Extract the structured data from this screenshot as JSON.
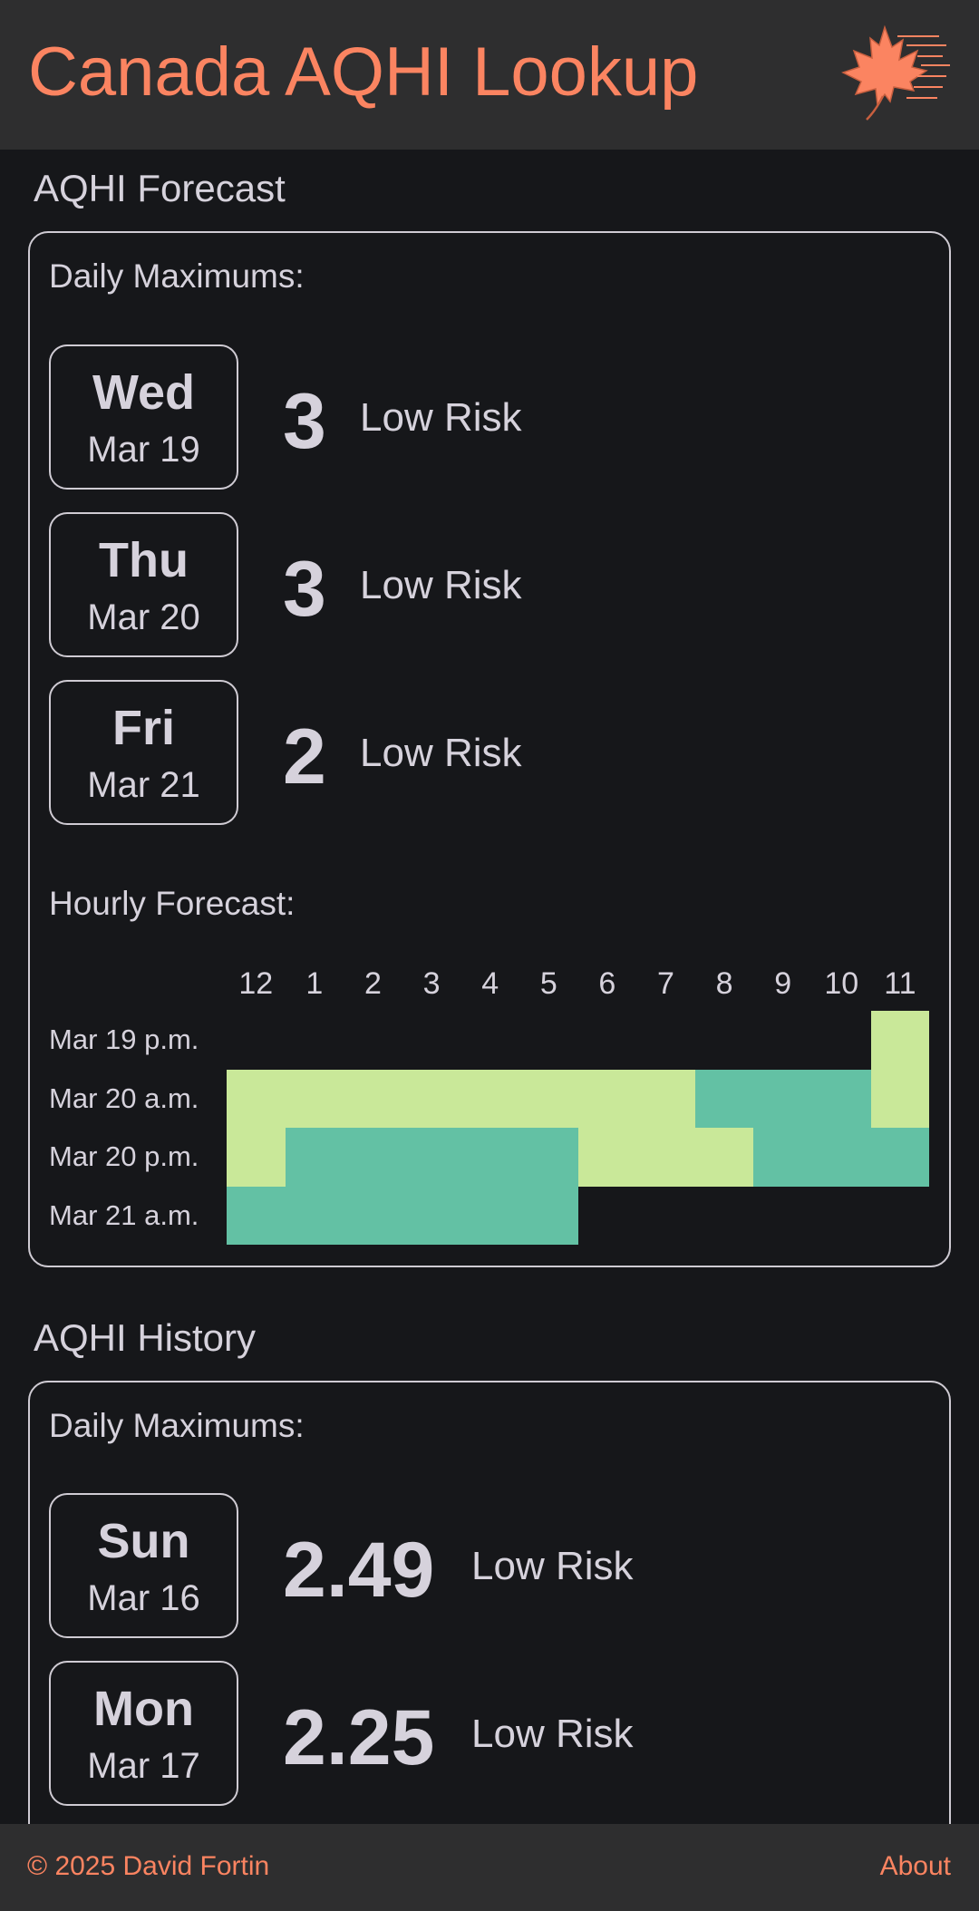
{
  "header": {
    "title": "Canada AQHI Lookup",
    "logo_icon": "maple-leaf-wind-icon",
    "accent_color": "#fb8461"
  },
  "forecast": {
    "title": "AQHI Forecast",
    "daily_title": "Daily Maximums:",
    "days": [
      {
        "day": "Wed",
        "date": "Mar 19",
        "value": "3",
        "risk": "Low Risk"
      },
      {
        "day": "Thu",
        "date": "Mar 20",
        "value": "3",
        "risk": "Low Risk"
      },
      {
        "day": "Fri",
        "date": "Mar 21",
        "value": "2",
        "risk": "Low Risk"
      }
    ],
    "hourly_title": "Hourly Forecast:",
    "hours": [
      "12",
      "1",
      "2",
      "3",
      "4",
      "5",
      "6",
      "7",
      "8",
      "9",
      "10",
      "11"
    ],
    "rows": [
      {
        "label": "Mar 19 p.m.",
        "values": [
          null,
          null,
          null,
          null,
          null,
          null,
          null,
          null,
          null,
          null,
          null,
          3
        ]
      },
      {
        "label": "Mar 20 a.m.",
        "values": [
          3,
          3,
          3,
          3,
          3,
          3,
          3,
          3,
          2,
          2,
          2,
          3
        ]
      },
      {
        "label": "Mar 20 p.m.",
        "values": [
          3,
          2,
          2,
          2,
          2,
          2,
          3,
          3,
          3,
          2,
          2,
          2
        ]
      },
      {
        "label": "Mar 21 a.m.",
        "values": [
          2,
          2,
          2,
          2,
          2,
          2,
          null,
          null,
          null,
          null,
          null,
          null
        ]
      }
    ],
    "level_colors": {
      "2": "#63c1a4",
      "3": "#c9e899"
    }
  },
  "history": {
    "title": "AQHI History",
    "daily_title": "Daily Maximums:",
    "days": [
      {
        "day": "Sun",
        "date": "Mar 16",
        "value": "2.49",
        "risk": "Low Risk"
      },
      {
        "day": "Mon",
        "date": "Mar 17",
        "value": "2.25",
        "risk": "Low Risk"
      }
    ]
  },
  "footer": {
    "copyright": "© 2025 David Fortin",
    "about_label": "About"
  }
}
